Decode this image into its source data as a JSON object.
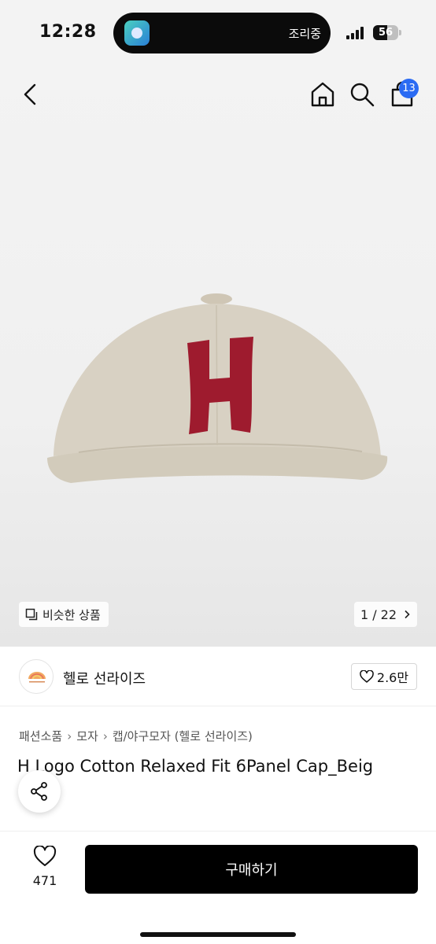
{
  "status_bar": {
    "time": "12:28",
    "island_text": "조리중",
    "battery": "56",
    "battery_level": 0.56
  },
  "nav": {
    "back_icon": "chevron-left-icon",
    "home_icon": "home-icon",
    "search_icon": "search-icon",
    "cart_icon": "cart-icon",
    "cart_count": "13"
  },
  "gallery": {
    "similar_label": "비슷한 상품",
    "page_indicator": "1 / 22",
    "colors": {
      "cap": "#d8d1c3",
      "logo": "#9e1b2e"
    }
  },
  "brand": {
    "name": "헬로 선라이즈",
    "likes": "2.6만"
  },
  "breadcrumb": [
    "패션소품",
    "모자",
    "캡/야구모자 (헬로 선라이즈)"
  ],
  "product": {
    "title": "H Logo Cotton Relaxed Fit 6Panel Cap_Beig"
  },
  "bottom_bar": {
    "wish_count": "471",
    "buy_label": "구매하기"
  },
  "colors": {
    "accent": "#2b6bf3",
    "buy_button": "#000000"
  }
}
